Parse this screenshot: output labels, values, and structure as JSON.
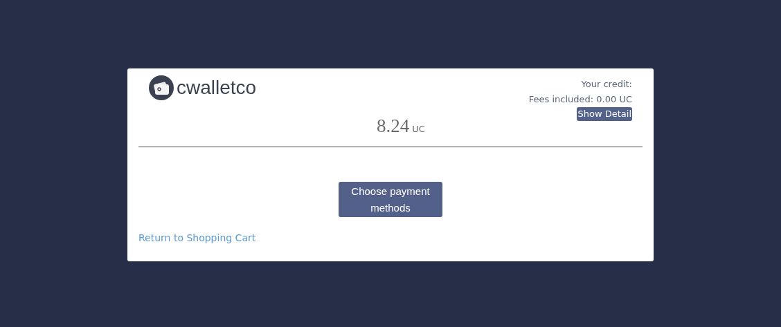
{
  "logo": {
    "name": "cwalletco"
  },
  "credit": {
    "label": "Your credit:",
    "fees": "Fees included: 0.00 UC",
    "detail_button": "Show Detail"
  },
  "amount": {
    "value": "8.24",
    "unit": "UC"
  },
  "pay_button": "Choose payment methods",
  "return_link": "Return to Shopping Cart"
}
